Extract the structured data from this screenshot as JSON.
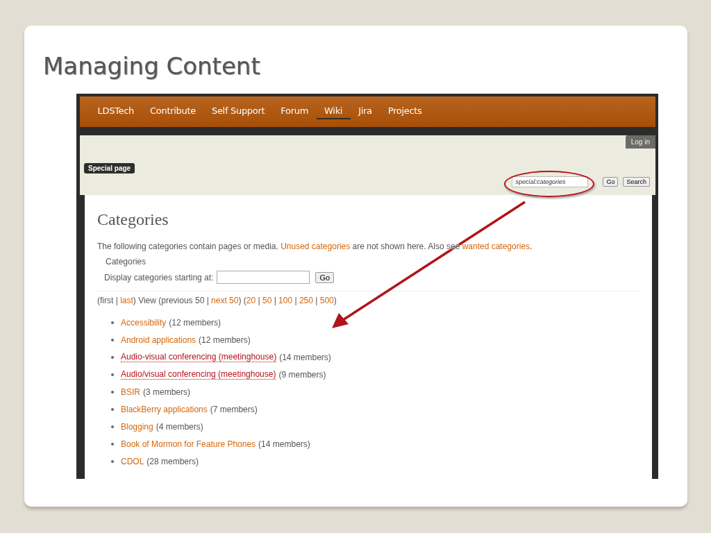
{
  "slide_title": "Managing Content",
  "nav": [
    {
      "label": "LDSTech",
      "selected": false
    },
    {
      "label": "Contribute",
      "selected": false
    },
    {
      "label": "Self Support",
      "selected": false
    },
    {
      "label": "Forum",
      "selected": false
    },
    {
      "label": "Wiki",
      "selected": true
    },
    {
      "label": "Jira",
      "selected": false
    },
    {
      "label": "Projects",
      "selected": false
    }
  ],
  "login": "Log in",
  "page_badge": "Special page",
  "search": {
    "value": "special:categories",
    "buttons": [
      "Go",
      "Search"
    ]
  },
  "heading": "Categories",
  "intro": [
    {
      "text": "The following categories contain pages or media. ",
      "link": false
    },
    {
      "text": "Unused categories",
      "link": true
    },
    {
      "text": " are not shown here. Also see ",
      "link": false
    },
    {
      "text": "wanted categories",
      "link": true
    },
    {
      "text": ".",
      "link": false
    }
  ],
  "form": {
    "legend": "Categories",
    "label": "Display categories starting at:",
    "button": "Go"
  },
  "paging": [
    {
      "text": "(first | ",
      "link": false
    },
    {
      "text": "last",
      "link": true
    },
    {
      "text": ") View (previous 50 | ",
      "link": false
    },
    {
      "text": "next 50",
      "link": true
    },
    {
      "text": ") (",
      "link": false
    },
    {
      "text": "20",
      "link": true
    },
    {
      "text": " | ",
      "link": false
    },
    {
      "text": "50",
      "link": true
    },
    {
      "text": " | ",
      "link": false
    },
    {
      "text": "100",
      "link": true
    },
    {
      "text": " | ",
      "link": false
    },
    {
      "text": "250",
      "link": true
    },
    {
      "text": " | ",
      "link": false
    },
    {
      "text": "500",
      "link": true
    },
    {
      "text": ")",
      "link": false
    }
  ],
  "categories": [
    {
      "name": "Accessibility",
      "count": "(12 members)",
      "missing": false
    },
    {
      "name": "Android applications",
      "count": "(12 members)",
      "missing": false
    },
    {
      "name": "Audio-visual conferencing (meetinghouse)",
      "count": "(14 members)",
      "missing": true
    },
    {
      "name": "Audio/visual conferencing (meetinghouse)",
      "count": "(9 members)",
      "missing": true
    },
    {
      "name": "BSIR",
      "count": "(3 members)",
      "missing": false
    },
    {
      "name": "BlackBerry applications",
      "count": "(7 members)",
      "missing": false
    },
    {
      "name": "Blogging",
      "count": "(4 members)",
      "missing": false
    },
    {
      "name": "Book of Mormon for Feature Phones",
      "count": "(14 members)",
      "missing": false
    },
    {
      "name": "CDOL",
      "count": "(28 members)",
      "missing": false
    }
  ]
}
